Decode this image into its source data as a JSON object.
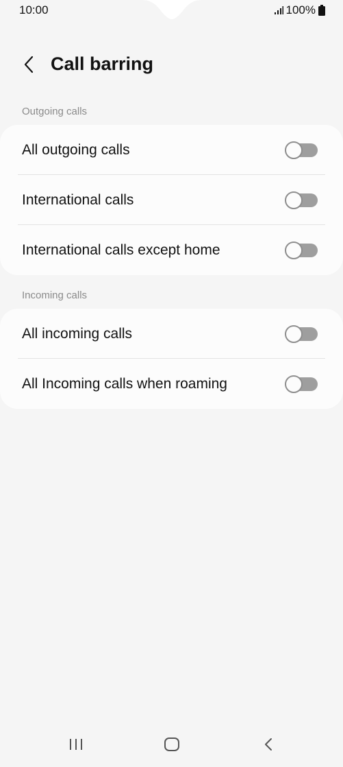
{
  "status_bar": {
    "time": "10:00",
    "battery": "100%",
    "signal_icon": "signal-icon",
    "battery_icon": "battery-icon"
  },
  "header": {
    "title": "Call barring",
    "back_icon": "chevron-left-icon"
  },
  "sections": [
    {
      "label": "Outgoing calls",
      "items": [
        {
          "label": "All outgoing calls",
          "enabled": false
        },
        {
          "label": "International calls",
          "enabled": false
        },
        {
          "label": "International calls except home",
          "enabled": false
        }
      ]
    },
    {
      "label": "Incoming calls",
      "items": [
        {
          "label": "All incoming calls",
          "enabled": false
        },
        {
          "label": "All Incoming calls when roaming",
          "enabled": false
        }
      ]
    }
  ],
  "nav_bar": {
    "recents_icon": "recents-icon",
    "home_icon": "home-icon",
    "back_icon": "back-icon"
  },
  "colors": {
    "background": "#f5f5f5",
    "card": "#fcfcfc",
    "toggle_off_track": "#9e9e9e"
  }
}
